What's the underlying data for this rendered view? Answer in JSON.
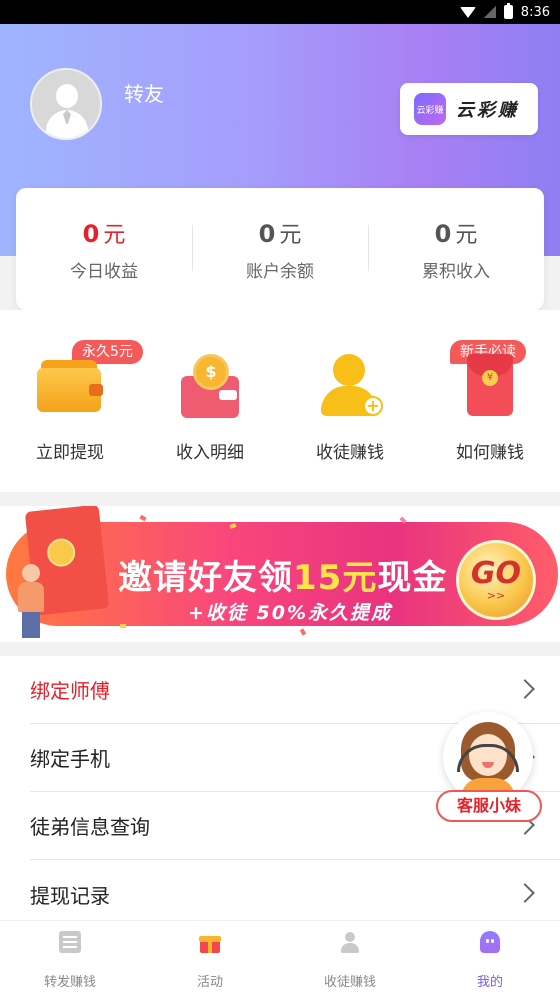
{
  "status_bar": {
    "time": "8:36"
  },
  "profile": {
    "username": "转友"
  },
  "brand": {
    "logo_text": "云彩赚",
    "name": "云彩赚"
  },
  "stats": [
    {
      "value": "0",
      "unit": "元",
      "label": "今日收益"
    },
    {
      "value": "0",
      "unit": "元",
      "label": "账户余额"
    },
    {
      "value": "0",
      "unit": "元",
      "label": "累积收入"
    }
  ],
  "actions": [
    {
      "label": "立即提现",
      "tag": "永久5元",
      "icon": "wallet-icon"
    },
    {
      "label": "收入明细",
      "icon": "income-detail-icon"
    },
    {
      "label": "收徒赚钱",
      "icon": "recruit-icon"
    },
    {
      "label": "如何赚钱",
      "tag": "新手必读",
      "icon": "red-envelope-icon"
    }
  ],
  "banner": {
    "title_prefix": "邀请好友领",
    "title_highlight": "15元",
    "title_suffix": "现金",
    "subtitle": "+收徒 50%永久提成",
    "go_label": "GO",
    "go_arrows": ">>"
  },
  "menu": [
    {
      "label": "绑定师傅"
    },
    {
      "label": "绑定手机"
    },
    {
      "label": "徒弟信息查询"
    },
    {
      "label": "提现记录"
    }
  ],
  "customer_service": {
    "label": "客服小妹"
  },
  "tabs": [
    {
      "label": "转发赚钱",
      "icon": "news-icon"
    },
    {
      "label": "活动",
      "icon": "gift-icon"
    },
    {
      "label": "收徒赚钱",
      "icon": "person-icon"
    },
    {
      "label": "我的",
      "icon": "ghost-icon",
      "active": true
    }
  ],
  "colors": {
    "accent": "#7b5cf0",
    "red": "#e8202a",
    "header_start": "#9fb5ff",
    "header_end": "#8f7ff2"
  }
}
